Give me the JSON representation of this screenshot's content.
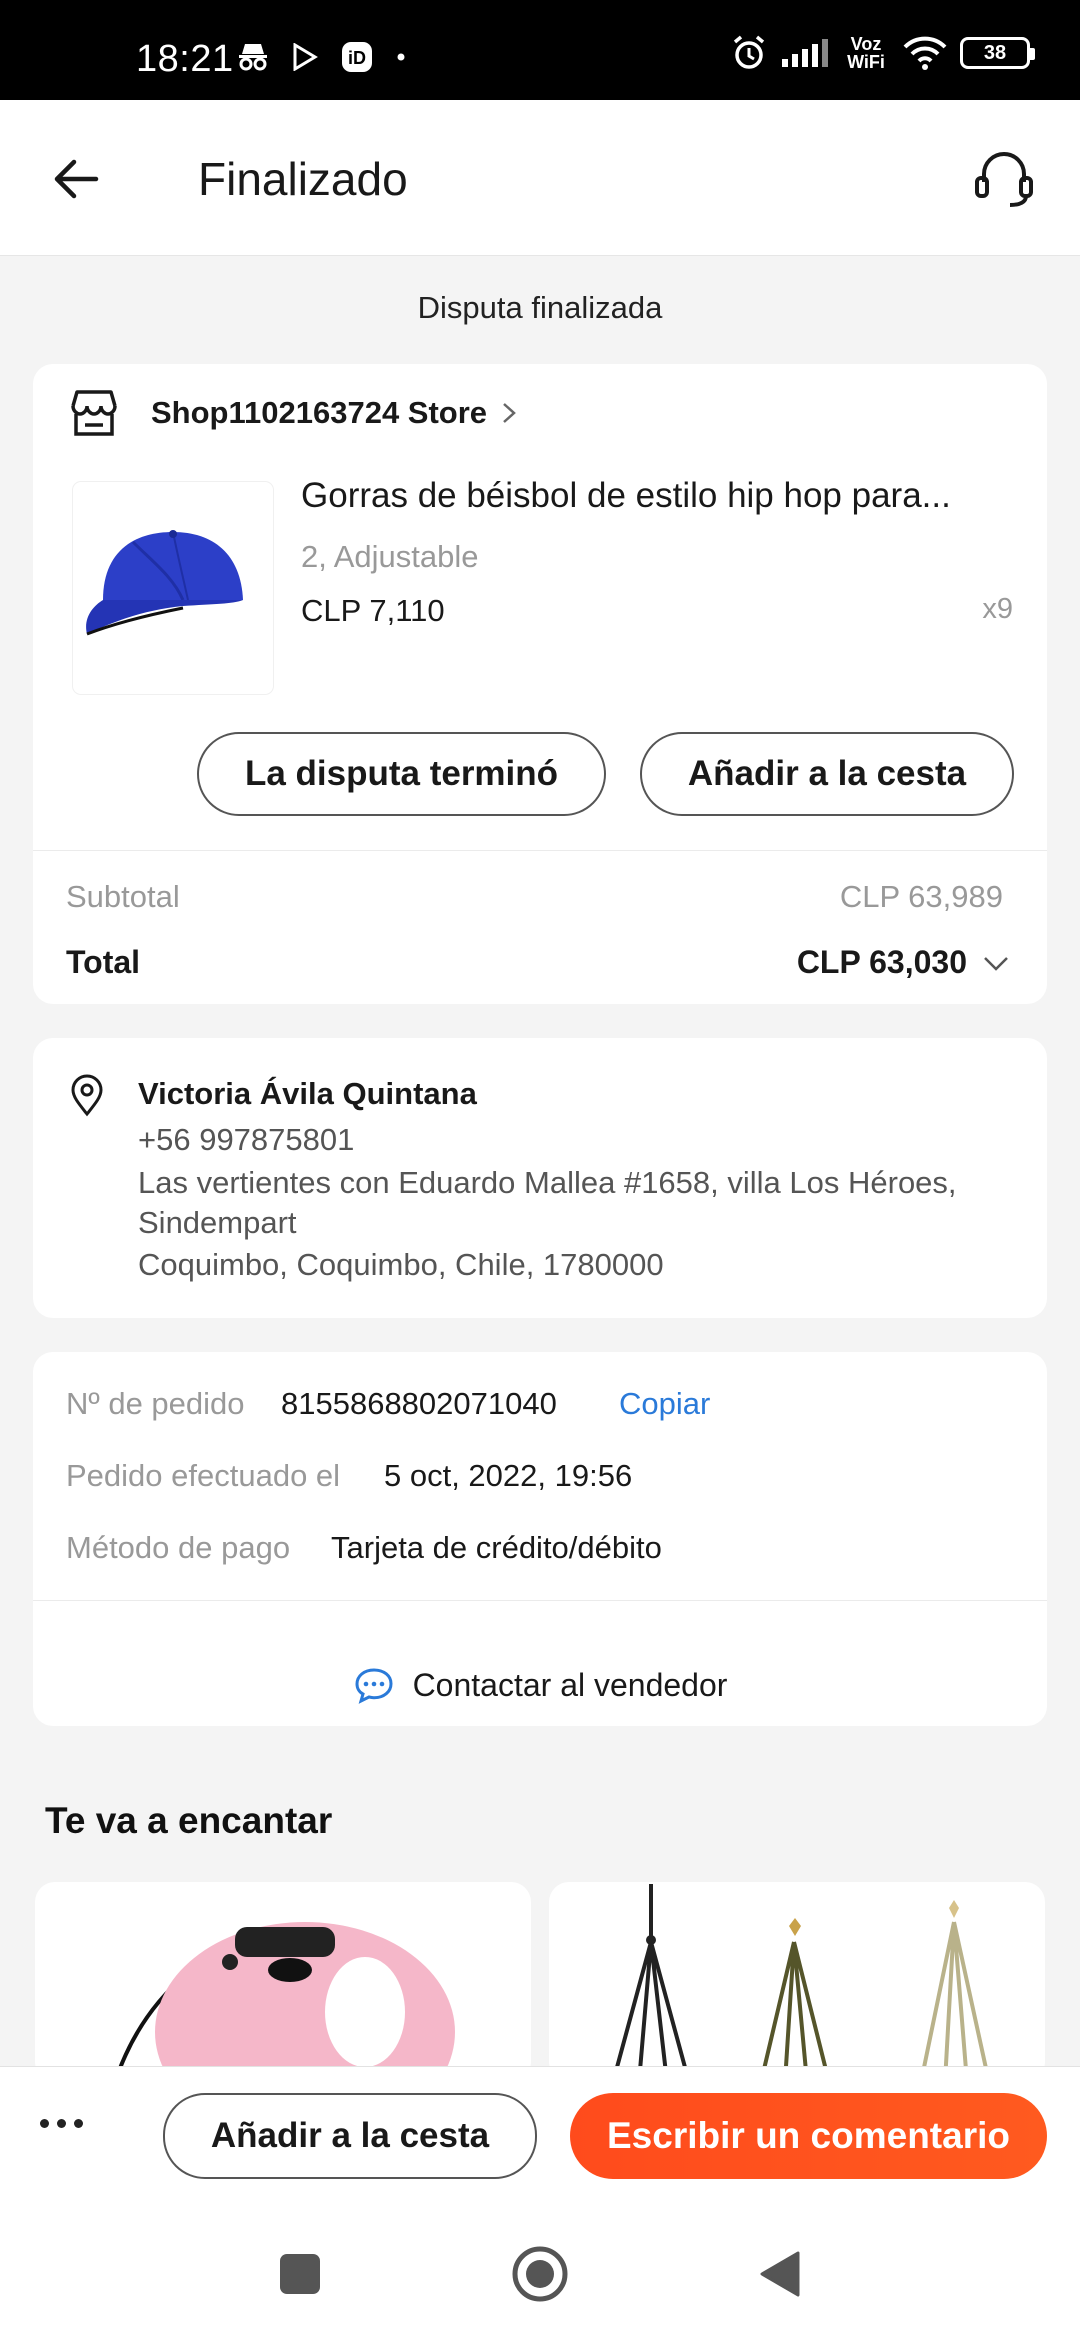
{
  "status_bar": {
    "time": "18:21",
    "network_label": "Voz WiFi",
    "battery": "38"
  },
  "header": {
    "title": "Finalizado",
    "back_icon": "arrow-left-icon",
    "support_icon": "headset-icon"
  },
  "dispute_banner": "Disputa finalizada",
  "order": {
    "store_name": "Shop1102163724 Store",
    "product": {
      "title": "Gorras de béisbol de estilo hip hop para...",
      "variant": "2, Adjustable",
      "price": "CLP 7,110",
      "quantity": "x9"
    },
    "buttons": {
      "dispute": "La disputa terminó",
      "add_to_cart": "Añadir a la cesta"
    },
    "summary": {
      "subtotal_label": "Subtotal",
      "subtotal_value": "CLP 63,989",
      "total_label": "Total",
      "total_value": "CLP 63,030"
    }
  },
  "address": {
    "name": "Victoria Ávila Quintana",
    "phone": "+56 997875801",
    "line1": "Las vertientes con Eduardo Mallea #1658, villa Los Héroes, Sindempart",
    "line2": "Coquimbo, Coquimbo, Chile, 1780000"
  },
  "order_info": {
    "number_label": "Nº de pedido",
    "number_value": "8155868802071040",
    "copy_label": "Copiar",
    "date_label": "Pedido efectuado el",
    "date_value": "5 oct, 2022, 19:56",
    "payment_label": "Método de pago",
    "payment_value": "Tarjeta de crédito/débito",
    "contact_label": "Contactar al vendedor"
  },
  "recommendations": {
    "title": "Te va a encantar"
  },
  "bottom_bar": {
    "add_to_cart": "Añadir a la cesta",
    "write_review": "Escribir un comentario"
  },
  "colors": {
    "accent": "#ff4b1c",
    "link": "#2a7ad9",
    "background": "#f4f4f4"
  }
}
